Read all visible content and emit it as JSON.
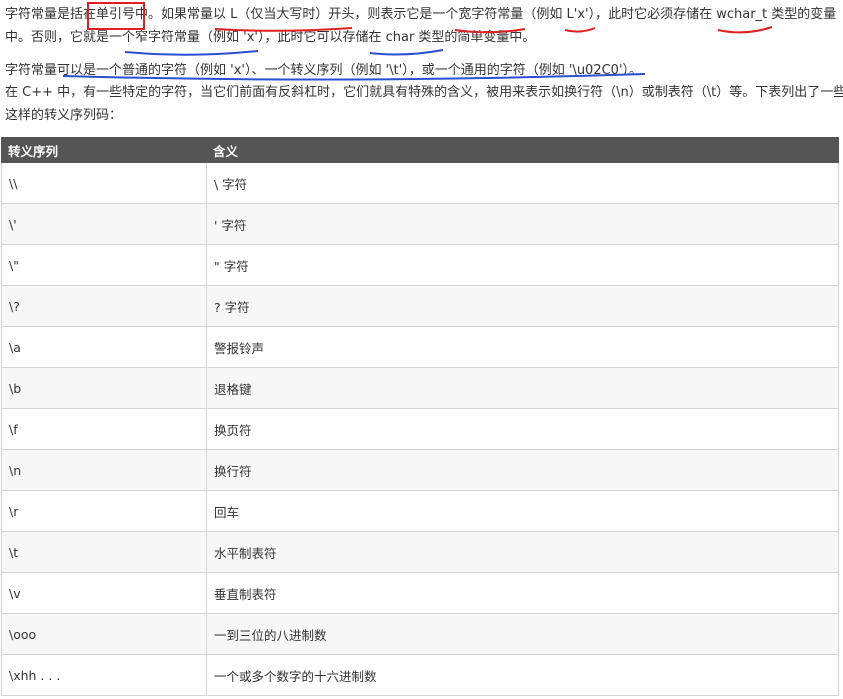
{
  "paragraphs": {
    "p1_line1": "字符常量是括在单引号中。如果常量以 L（仅当大写时）开头，则表示它是一个宽字符常量（例如 L'x'），此时它必须存储在 wchar_t 类型的变量",
    "p1_line2": "中。否则，它就是一个窄字符常量（例如 'x'），此时它可以存储在 char 类型的简单变量中。",
    "p2": "字符常量可以是一个普通的字符（例如 'x'）、一个转义序列（例如 '\\t'），或一个通用的字符（例如 '\\u02C0'）。",
    "p3_line1": "在 C++ 中，有一些特定的字符，当它们前面有反斜杠时，它们就具有特殊的含义，被用来表示如换行符（\\n）或制表符（\\t）等。下表列出了一些",
    "p3_line2": "这样的转义序列码："
  },
  "table": {
    "headers": [
      "转义序列",
      "含义"
    ],
    "rows": [
      [
        "\\\\",
        "\\ 字符"
      ],
      [
        "\\'",
        "' 字符"
      ],
      [
        "\\\"",
        "\" 字符"
      ],
      [
        "\\?",
        "? 字符"
      ],
      [
        "\\a",
        "警报铃声"
      ],
      [
        "\\b",
        "退格键"
      ],
      [
        "\\f",
        "换页符"
      ],
      [
        "\\n",
        "换行符"
      ],
      [
        "\\r",
        "回车"
      ],
      [
        "\\t",
        "水平制表符"
      ],
      [
        "\\v",
        "垂直制表符"
      ],
      [
        "\\ooo",
        "一到三位的八进制数"
      ],
      [
        "\\xhh . . .",
        "一个或多个数字的十六进制数"
      ]
    ]
  },
  "colors": {
    "red_annotation": "#e02020",
    "blue_annotation": "#2a4fd0",
    "header_bg": "#555555"
  }
}
